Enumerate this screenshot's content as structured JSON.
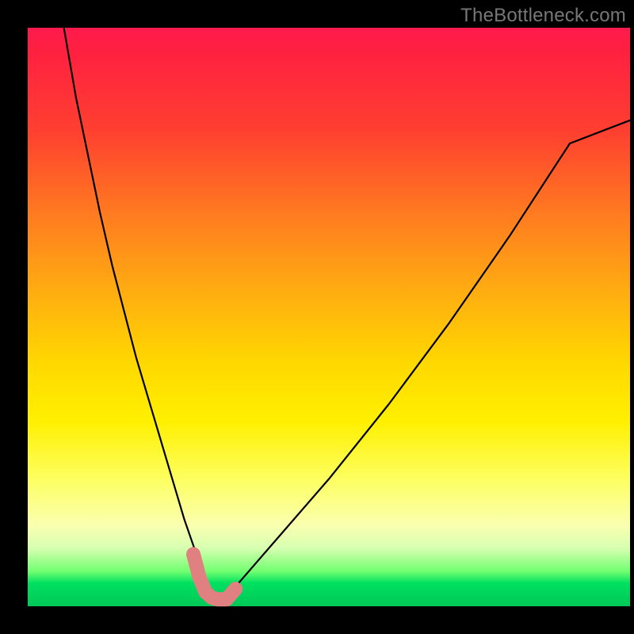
{
  "watermark": "TheBottleneck.com",
  "colors": {
    "background": "#000000",
    "gradient_top": "#ff1a4d",
    "gradient_mid": "#ffd800",
    "gradient_bottom": "#00c858",
    "curve": "#000000",
    "marker": "#e08080"
  },
  "chart_data": {
    "type": "line",
    "title": "",
    "xlabel": "",
    "ylabel": "",
    "xlim": [
      0,
      100
    ],
    "ylim": [
      0,
      100
    ],
    "note": "V-shaped bottleneck curve. y≈0 at the trough; y rises toward 100 at the edges. Values estimated from pixel positions (no axis ticks rendered).",
    "series": [
      {
        "name": "bottleneck-curve",
        "x": [
          6,
          8,
          10,
          12,
          14,
          16,
          18,
          20,
          22,
          24,
          26,
          28,
          29,
          30,
          31,
          33,
          35,
          40,
          50,
          60,
          70,
          80,
          90,
          100
        ],
        "y": [
          100,
          88,
          78,
          68,
          59,
          51,
          43,
          36,
          29,
          22,
          15,
          9,
          5,
          2,
          1,
          1,
          4,
          10,
          22,
          35,
          49,
          64,
          80,
          84
        ]
      }
    ],
    "highlight": {
      "name": "trough-marker",
      "x": [
        27.5,
        28.5,
        29.5,
        30.5,
        31.5,
        33,
        34.5
      ],
      "y": [
        9,
        5,
        2.5,
        1.5,
        1.2,
        1.2,
        3
      ],
      "color": "#e08080"
    }
  }
}
